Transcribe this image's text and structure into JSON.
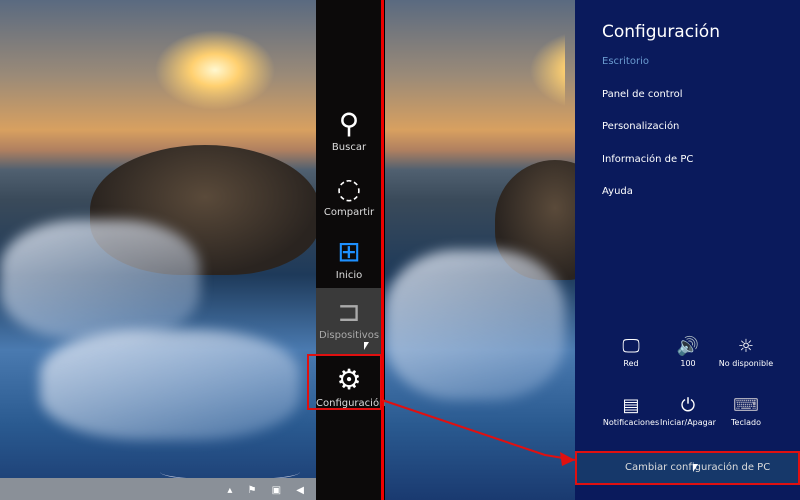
{
  "charms": [
    {
      "label": "Buscar",
      "icon": "search-icon"
    },
    {
      "label": "Compartir",
      "icon": "share-icon"
    },
    {
      "label": "Inicio",
      "icon": "windows-logo-icon"
    },
    {
      "label": "Dispositivos",
      "icon": "devices-icon"
    },
    {
      "label": "Configuración",
      "icon": "gear-icon"
    }
  ],
  "settings": {
    "title": "Configuración",
    "context": "Escritorio",
    "items": [
      "Panel de control",
      "Personalización",
      "Información de PC",
      "Ayuda"
    ],
    "quick": [
      {
        "label": "Red",
        "icon": "network-icon"
      },
      {
        "label": "100",
        "icon": "volume-icon"
      },
      {
        "label": "No disponible",
        "icon": "brightness-icon"
      },
      {
        "label": "Notificaciones",
        "icon": "notifications-icon"
      },
      {
        "label": "Iniciar/Apagar",
        "icon": "power-icon"
      },
      {
        "label": "Teclado",
        "icon": "keyboard-icon"
      }
    ],
    "change_pc_settings": "Cambiar configuración de PC"
  },
  "colors": {
    "panel": "#0a1a5c",
    "highlight": "#e01010",
    "windows_blue": "#1e90ff"
  }
}
